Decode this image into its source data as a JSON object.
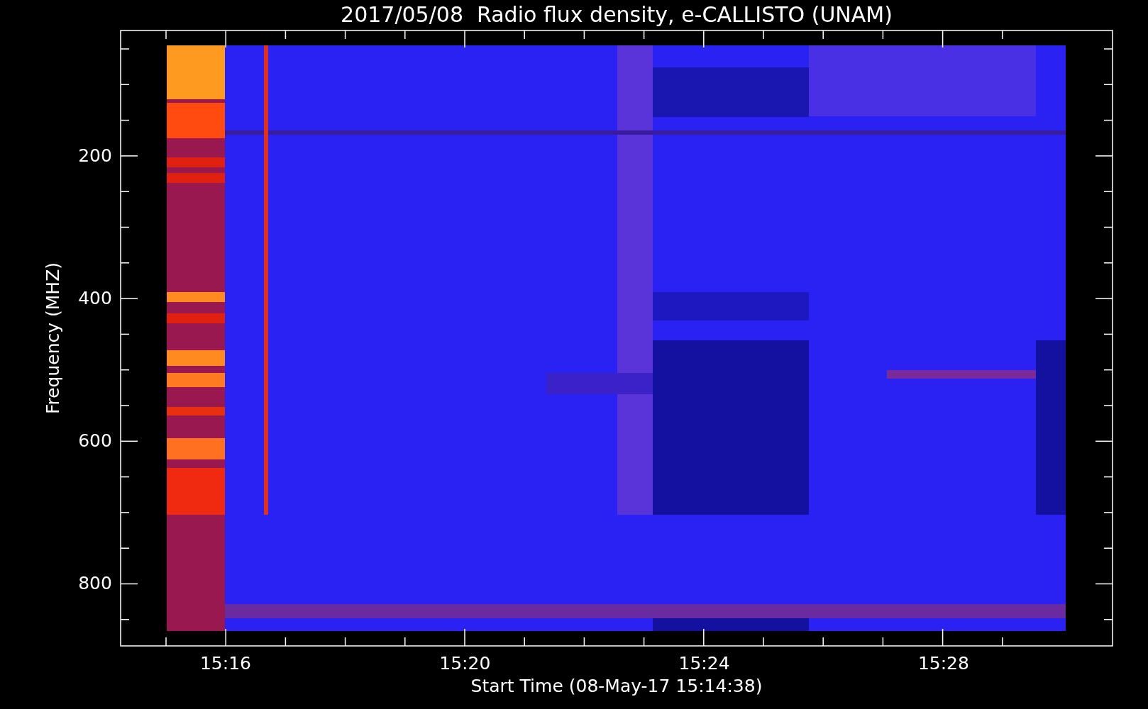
{
  "plot": {
    "title": "2017/05/08  Radio flux density, e-CALLISTO (UNAM)",
    "ylabel": "Frequency (MHZ)",
    "xlabel": "Start Time (08-May-17 15:14:38)",
    "yticks": [
      "200",
      "400",
      "600",
      "800"
    ],
    "xticks": [
      "15:16",
      "15:20",
      "15:24",
      "15:28"
    ]
  }
}
